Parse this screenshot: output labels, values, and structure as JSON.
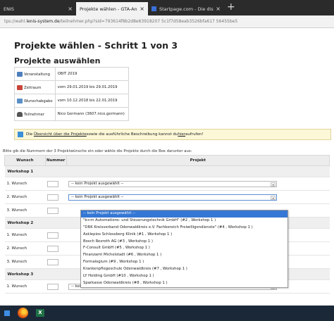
{
  "browser": {
    "tabs": [
      {
        "label": "ENIS",
        "close": "×"
      },
      {
        "label": "Projekte wählen - GTA-Angebote",
        "close": "×"
      },
      {
        "label": "Startpage.com - Die diskreteste",
        "close": "×"
      }
    ],
    "new_tab": "+",
    "url_prefix": "tps://wahl.",
    "url_host": "lenis-system.de",
    "url_path": "/teilnehmer.php?sid=793614f8b2d8e63918207 5c1f7d58eab3526bfa617 56455be5"
  },
  "page": {
    "title": "Projekte wählen - Schritt 1 von 3",
    "subtitle": "Projekte auswählen",
    "info": [
      {
        "icon": "calendar-icon",
        "label": "Veranstaltung",
        "value": "OBIT 2019"
      },
      {
        "icon": "clock-icon",
        "label": "Zeitraum",
        "value": "vom 29.01.2019 bis 29.01.2019"
      },
      {
        "icon": "register-icon",
        "label": "Wunschabgabe",
        "value": "vom 10.12.2018 bis 22.01.2019"
      },
      {
        "icon": "user-icon",
        "label": "Teilnehmer",
        "value": "Nico Germann (3607.nico.germann)"
      }
    ],
    "notice": {
      "link1": "Übersicht über die Projekte",
      "text_mid": " sowie die ausführliche Beschreibung kannst du ",
      "link2": "hier",
      "text_end": " aufrufen!"
    },
    "hint": "Bitte gib die Nummern der 3 Projektwünsche ein oder wähle die Projekte durch die Box darunter aus:",
    "table": {
      "headers": [
        "Wunsch",
        "Nummer",
        "Projekt"
      ],
      "workshops": [
        {
          "name": "Workshop 1",
          "rows": [
            {
              "wish": "1. Wunsch",
              "project": "-- kein Projekt ausgewählt --"
            },
            {
              "wish": "2. Wunsch",
              "project": "-- kein Projekt ausgewählt --"
            },
            {
              "wish": "3. Wunsch",
              "project": ""
            }
          ]
        },
        {
          "name": "Workshop 2",
          "rows": [
            {
              "wish": "1. Wunsch",
              "project": ""
            },
            {
              "wish": "2. Wunsch",
              "project": ""
            },
            {
              "wish": "3. Wunsch",
              "project": ""
            }
          ]
        },
        {
          "name": "Workshop 3",
          "rows": [
            {
              "wish": "1. Wunsch",
              "project": "-- kein Projekt ausgewählt --"
            }
          ]
        }
      ]
    },
    "dropdown_options": [
      "-- kein Projekt ausgewählt --",
      "\"b+m Automations- und Steuerungstechnik GmbH\" (#2 , Workshop 1 )",
      "\"DRK Kreisverband Odenwaldkreis e.V. Fachbereich Freiwilligendienste\" (#4 , Workshop 1 )",
      "Asklepios Schlossberg Klinik (#1 , Workshop 1 )",
      "Bosch Rexroth AG (#3 , Workshop 1 )",
      "F-Consult GmbH (#5 , Workshop 1 )",
      "Finanzamt Michelstadt (#6 , Workshop 1 )",
      "Formalogium (#9 , Workshop 1 )",
      "Krankenpflegeschule Odenwaldkreis (#7 , Workshop 1 )",
      "LY Holding GmbH (#10 , Workshop 1 )",
      "Sparkasse Odenwaldkreis (#8 , Workshop 1 )"
    ],
    "dropdown_arrow": "▾"
  },
  "taskbar": {
    "excel_label": "X"
  }
}
